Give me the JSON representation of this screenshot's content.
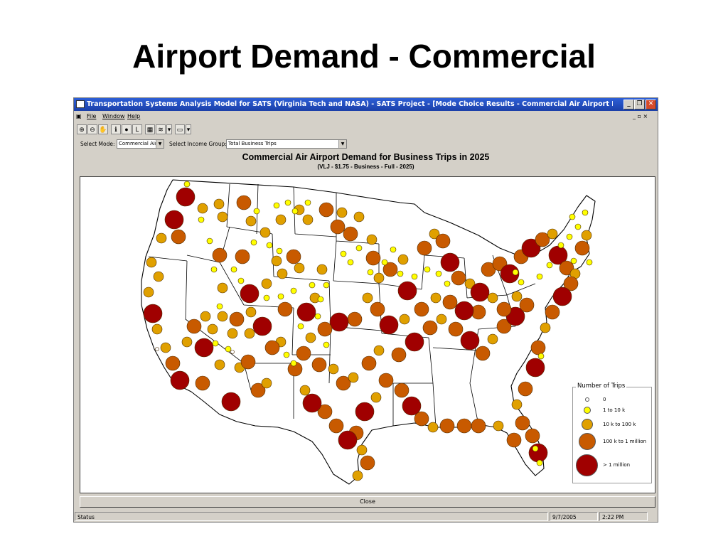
{
  "slide": {
    "title": "Airport Demand - Commercial"
  },
  "window": {
    "title": "Transportation Systems Analysis Model for SATS (Virginia Tech and NASA) - SATS Project - [Mode Choice Results - Commercial Air Airport Demand for Business Tri]",
    "menu": [
      "File",
      "Window",
      "Help"
    ],
    "mdi_controls": "_ ▫ ×"
  },
  "controls": {
    "mode_label": "Select Mode:",
    "mode_value": "Commercial Air",
    "income_label": "Select Income Group:",
    "income_value": "Total Business Trips"
  },
  "map": {
    "title": "Commercial Air Airport Demand for Business Trips in 2025",
    "subtitle": "(VLJ - $1.75 - Business - Full - 2025)",
    "colors": {
      "cat0": "#ffffff",
      "cat1": "#ffff00",
      "cat2": "#e0a000",
      "cat3": "#c85a00",
      "cat4": "#a00000"
    }
  },
  "legend": {
    "title": "Number of Trips",
    "items": [
      {
        "label": "0",
        "cat": 0
      },
      {
        "label": "1 to 10 k",
        "cat": 1
      },
      {
        "label": "10 k to 100 k",
        "cat": 2
      },
      {
        "label": "100 k to 1 million",
        "cat": 3
      },
      {
        "label": "> 1 million",
        "cat": 4
      }
    ]
  },
  "buttons": {
    "close": "Close"
  },
  "status": {
    "label": "Status",
    "date": "9/7/2005",
    "time": "2:22 PM"
  }
}
